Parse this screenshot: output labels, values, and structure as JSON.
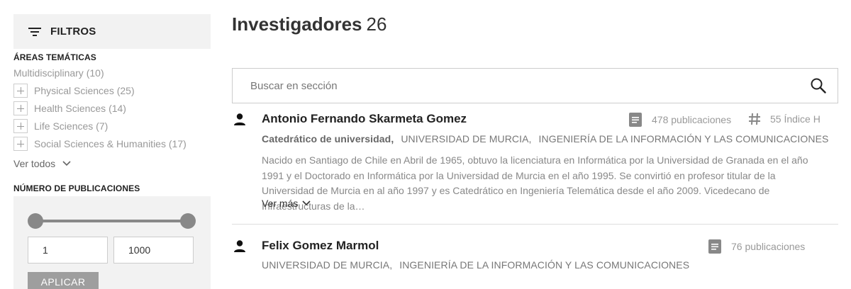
{
  "sidebar": {
    "filters_label": "FILTROS",
    "areas_title": "ÁREAS TEMÁTICAS",
    "areas": [
      {
        "label": "Multidisciplinary",
        "count": "(10)",
        "expandable": false
      },
      {
        "label": "Physical Sciences",
        "count": "(25)",
        "expandable": true
      },
      {
        "label": "Health Sciences",
        "count": "(14)",
        "expandable": true
      },
      {
        "label": "Life Sciences",
        "count": "(7)",
        "expandable": true
      },
      {
        "label": "Social Sciences & Humanities",
        "count": "(17)",
        "expandable": true
      }
    ],
    "see_all": "Ver todos",
    "publications_title": "NÚMERO DE PUBLICACIONES",
    "range_min": "1",
    "range_max": "1000",
    "apply_label": "APLICAR"
  },
  "main": {
    "title": "Investigadores",
    "count": "26",
    "search_placeholder": "Buscar en sección",
    "results": [
      {
        "name": "Antonio Fernando Skarmeta Gomez",
        "publications": "478 publicaciones",
        "h_index": "55 Índice H",
        "position": "Catedrático de universidad,",
        "institution": "UNIVERSIDAD DE MURCIA,",
        "department": "INGENIERÍA DE LA INFORMACIÓN Y LAS COMUNICACIONES",
        "description": "Nacido en Santiago de Chile en Abril de 1965, obtuvo la licenciatura en Informática por la Universidad de Granada en el año 1991 y el Doctorado en Informática por la Universidad de Murcia en el año 1995. Se convirtió en profesor titular de la Universidad de Murcia en al año 1997 y es Catedrático en Ingeniería Telemática desde el año 2009. Vicedecano de Infraestructuras de la…",
        "more": "Ver más"
      },
      {
        "name": "Felix Gomez Marmol",
        "publications": "76 publicaciones",
        "institution": "UNIVERSIDAD DE MURCIA,",
        "department": "INGENIERÍA DE LA INFORMACIÓN Y LAS COMUNICACIONES"
      }
    ]
  },
  "icons": {
    "filter": "filter-lines-icon",
    "search": "magnifier-icon",
    "person": "person-icon",
    "publications": "document-icon",
    "h_index": "hash-icon",
    "chevron": "chevron-down-icon"
  },
  "colors": {
    "panel_bg": "#f2f2f2",
    "apply_button": "#9e9e9e",
    "muted_text": "#999999"
  }
}
